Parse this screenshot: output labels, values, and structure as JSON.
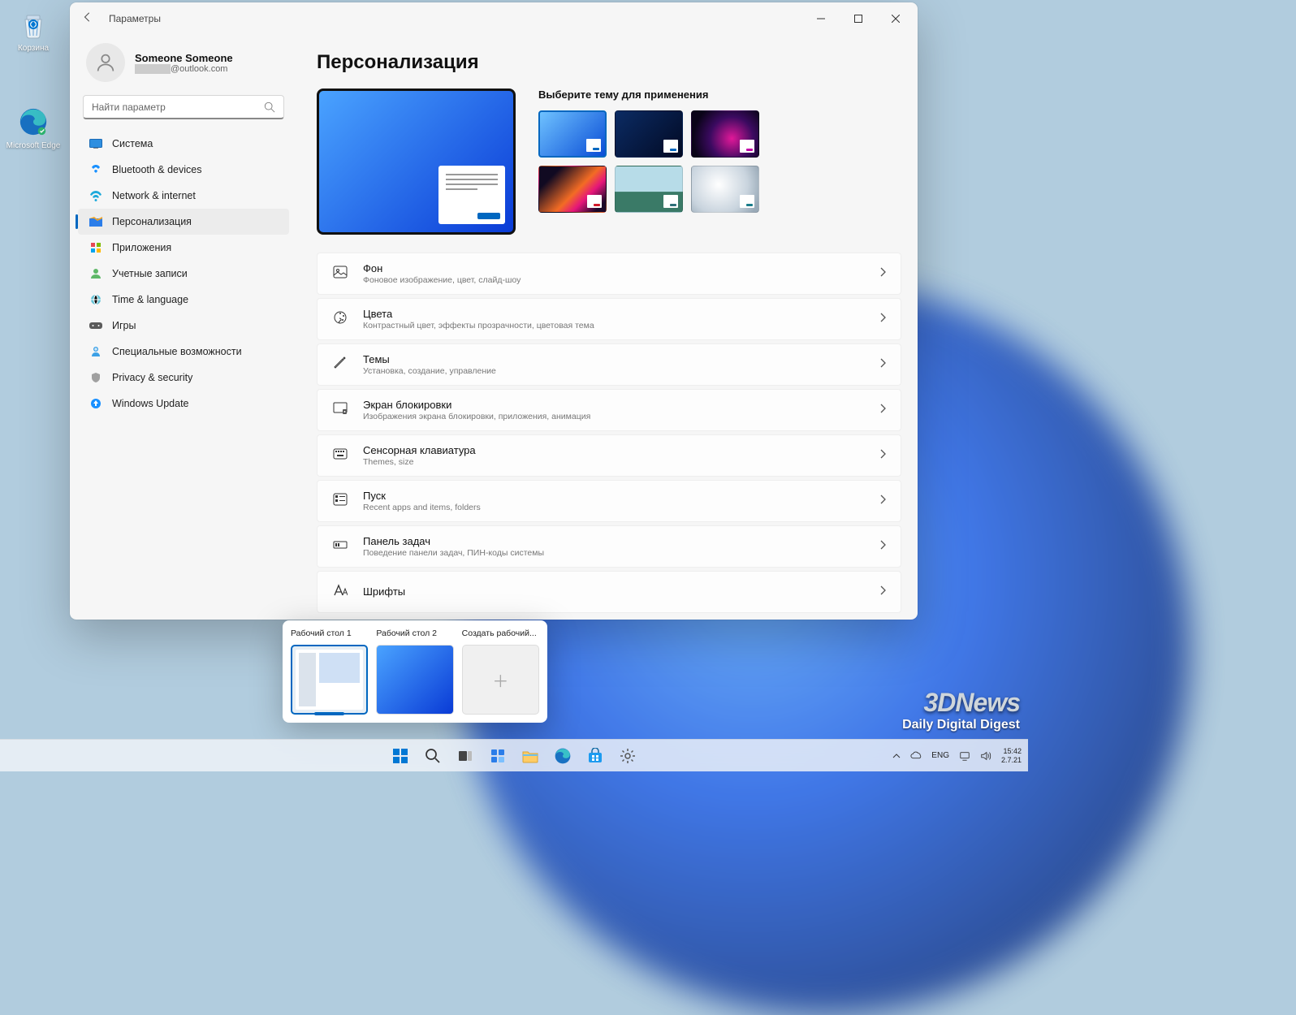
{
  "desktop": {
    "icons": [
      {
        "label": "Корзина"
      },
      {
        "label": "Microsoft Edge"
      }
    ]
  },
  "window": {
    "app_title": "Параметры",
    "account": {
      "name": "Someone Someone",
      "email_suffix": "@outlook.com"
    },
    "search_placeholder": "Найти параметр",
    "nav": [
      {
        "label": "Система"
      },
      {
        "label": "Bluetooth & devices"
      },
      {
        "label": "Network & internet"
      },
      {
        "label": "Персонализация"
      },
      {
        "label": "Приложения"
      },
      {
        "label": "Учетные записи"
      },
      {
        "label": "Time & language"
      },
      {
        "label": "Игры"
      },
      {
        "label": "Специальные возможности"
      },
      {
        "label": "Privacy & security"
      },
      {
        "label": "Windows Update"
      }
    ],
    "nav_active_index": 3,
    "page_title": "Персонализация",
    "theme_heading": "Выберите тему для применения",
    "themes": [
      {
        "bg": "linear-gradient(135deg,#6fc2ff,#0a4dd6)",
        "accent": "#0067c0",
        "selected": true
      },
      {
        "bg": "linear-gradient(135deg,#0b2b63,#020a24)",
        "accent": "#0067c0",
        "selected": false
      },
      {
        "bg": "radial-gradient(circle at 60% 60%,#e11899 0%,#3b0a60 45%,#0a0418 80%)",
        "accent": "#c400a8",
        "selected": false
      },
      {
        "bg": "linear-gradient(135deg,#110a22 20%,#f36c24 55%,#e5157a 70%,#1a0a2a 90%)",
        "accent": "#d11a2a",
        "selected": false
      },
      {
        "bg": "linear-gradient(#b7dce8 0%,#b7dce8 55%,#3a7a67 56%,#3a7a67 100%)",
        "accent": "#2d6f78",
        "selected": false
      },
      {
        "bg": "radial-gradient(circle at 40% 40%,#fff,#c9d4de 60%,#9aaab8 90%)",
        "accent": "#197c8a",
        "selected": false
      }
    ],
    "settings": [
      {
        "title": "Фон",
        "sub": "Фоновое изображение, цвет, слайд-шоу"
      },
      {
        "title": "Цвета",
        "sub": "Контрастный цвет, эффекты прозрачности, цветовая тема"
      },
      {
        "title": "Темы",
        "sub": "Установка, создание, управление"
      },
      {
        "title": "Экран блокировки",
        "sub": "Изображения экрана блокировки, приложения, анимация"
      },
      {
        "title": "Сенсорная клавиатура",
        "sub": "Themes, size"
      },
      {
        "title": "Пуск",
        "sub": "Recent apps and items, folders"
      },
      {
        "title": "Панель задач",
        "sub": "Поведение панели задач, ПИН-коды системы"
      },
      {
        "title": "Шрифты",
        "sub": ""
      }
    ]
  },
  "taskview": {
    "items": [
      {
        "label": "Рабочий стол 1",
        "selected": true
      },
      {
        "label": "Рабочий стол 2",
        "selected": false
      },
      {
        "label": "Создать рабочий...",
        "is_new": true
      }
    ]
  },
  "taskbar": {
    "lang": "ENG",
    "time": "15:42",
    "date": "2.7.21"
  },
  "watermark": {
    "top": "3DNews",
    "bottom": "Daily Digital Digest"
  }
}
